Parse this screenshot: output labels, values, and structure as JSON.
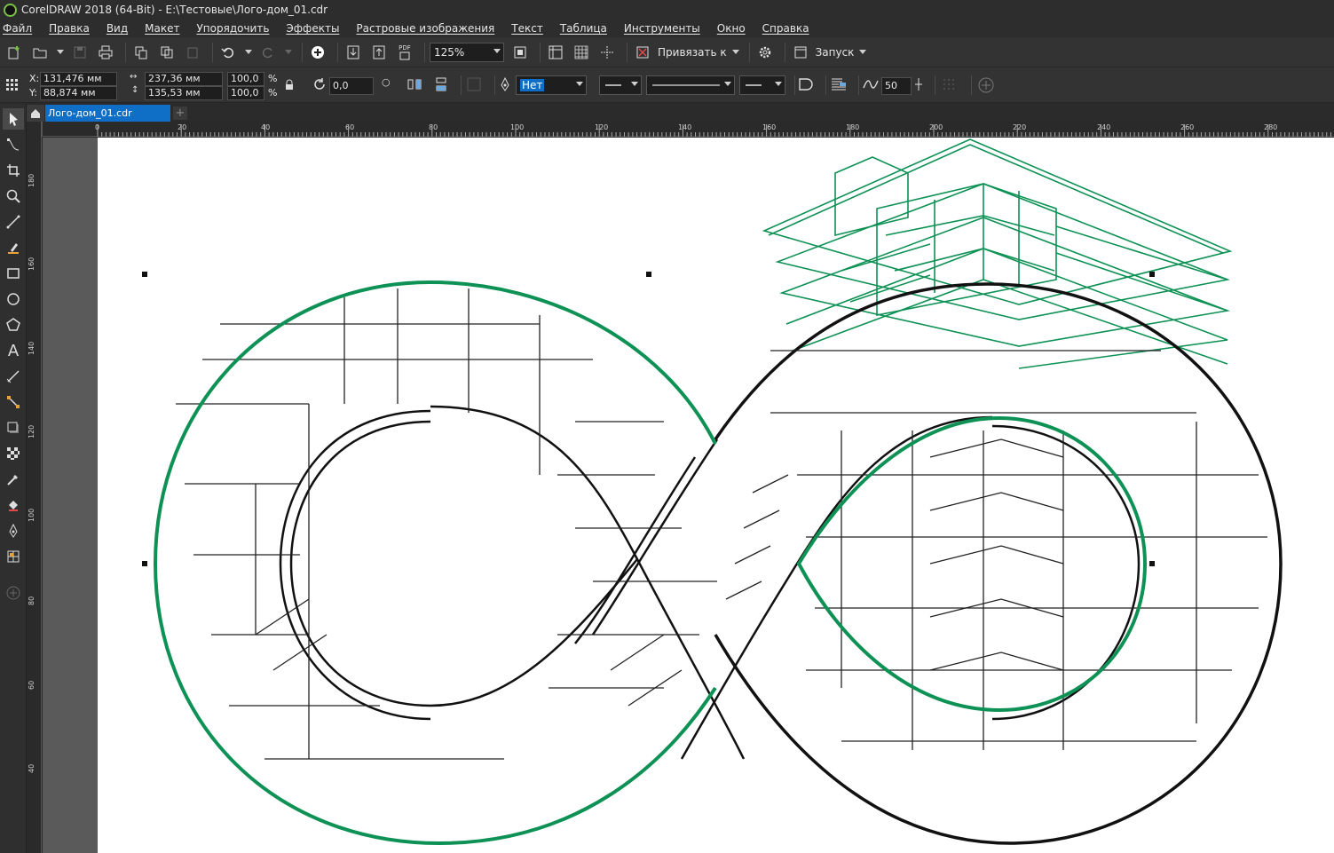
{
  "window": {
    "title": "CorelDRAW 2018 (64-Bit) - E:\\Тестовые\\Лого-дом_01.cdr"
  },
  "menu": [
    "Файл",
    "Правка",
    "Вид",
    "Макет",
    "Упорядочить",
    "Эффекты",
    "Растровые изображения",
    "Текст",
    "Таблица",
    "Инструменты",
    "Окно",
    "Справка"
  ],
  "toolbar": {
    "pdf_label": "PDF",
    "zoom_value": "125%",
    "snap_label": "Привязать к",
    "launch_label": "Запуск"
  },
  "propbar": {
    "x_label": "X:",
    "x_value": "131,476 мм",
    "y_label": "Y:",
    "y_value": "88,874 мм",
    "width_value": "237,36 мм",
    "height_value": "135,53 мм",
    "scale_x": "100,0",
    "scale_y": "100,0",
    "percent": "%",
    "rotation": "0,0",
    "fill_value": "Нет",
    "smooth_value": "50"
  },
  "document": {
    "tab_name": "Лого-дом_01.cdr"
  },
  "rulers": {
    "horizontal": [
      "0",
      "20",
      "40",
      "60",
      "80",
      "100",
      "120",
      "140",
      "160",
      "180",
      "200",
      "220",
      "240",
      "260",
      "280"
    ],
    "vertical": [
      "180",
      "160",
      "140",
      "120",
      "100",
      "80",
      "60",
      "40"
    ]
  },
  "colors": {
    "accent": "#0f6fc6",
    "outline_green": "#0e9155",
    "canvas_bg": "#5a5a5a"
  }
}
